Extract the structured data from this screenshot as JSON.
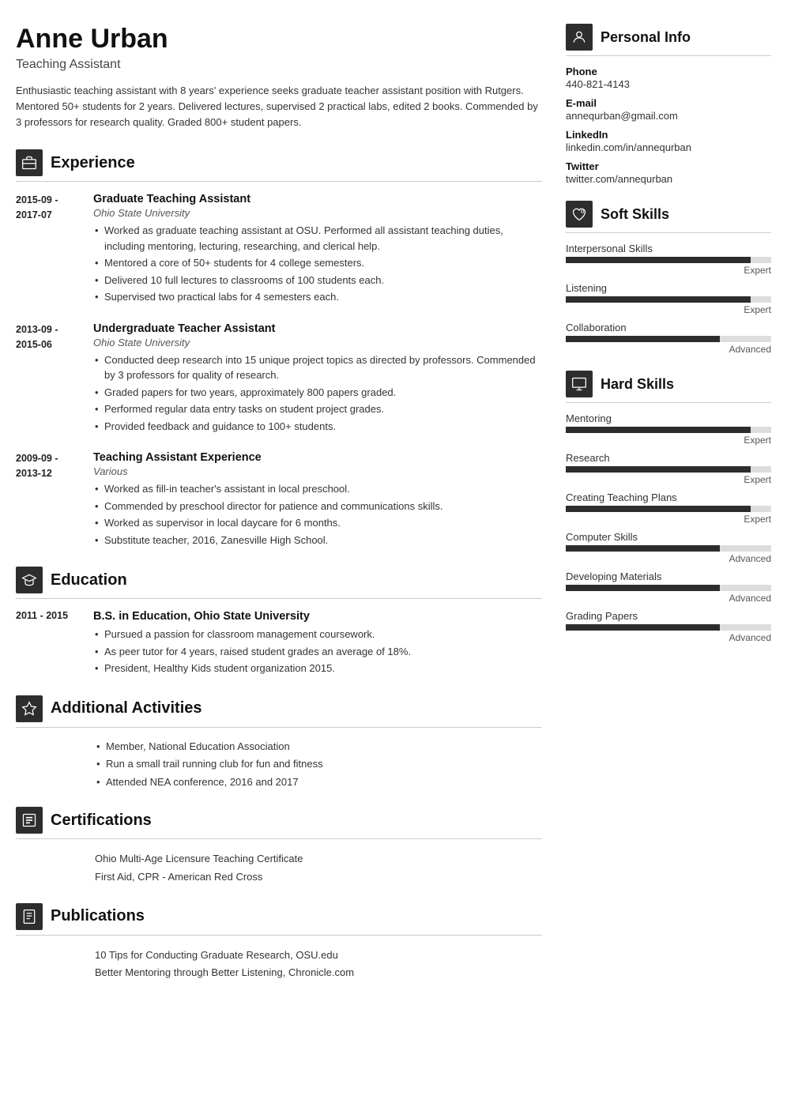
{
  "header": {
    "name": "Anne Urban",
    "title": "Teaching Assistant",
    "summary": "Enthusiastic teaching assistant with 8 years' experience seeks graduate teacher assistant position with Rutgers. Mentored 50+ students for 2 years. Delivered lectures, supervised 2 practical labs, edited 2 books. Commended by 3 professors for research quality. Graded 800+ student papers."
  },
  "sections": {
    "experience": {
      "title": "Experience",
      "entries": [
        {
          "dates": "2015-09 - 2017-07",
          "job_title": "Graduate Teaching Assistant",
          "org": "Ohio State University",
          "bullets": [
            "Worked as graduate teaching assistant at OSU. Performed all assistant teaching duties, including mentoring, lecturing, researching, and clerical help.",
            "Mentored a core of 50+ students for 4 college semesters.",
            "Delivered 10 full lectures to classrooms of 100 students each.",
            "Supervised two practical labs for 4 semesters each."
          ]
        },
        {
          "dates": "2013-09 - 2015-06",
          "job_title": "Undergraduate Teacher Assistant",
          "org": "Ohio State University",
          "bullets": [
            "Conducted deep research into 15 unique project topics as directed by professors. Commended by 3 professors for quality of research.",
            "Graded papers for two years, approximately 800 papers graded.",
            "Performed regular data entry tasks on student project grades.",
            "Provided feedback and guidance to 100+ students."
          ]
        },
        {
          "dates": "2009-09 - 2013-12",
          "job_title": "Teaching Assistant Experience",
          "org": "Various",
          "bullets": [
            "Worked as fill-in teacher's assistant in local preschool.",
            "Commended by preschool director for patience and communications skills.",
            "Worked as supervisor in local daycare for 6 months.",
            "Substitute teacher, 2016, Zanesville High School."
          ]
        }
      ]
    },
    "education": {
      "title": "Education",
      "entries": [
        {
          "dates": "2011 - 2015",
          "degree": "B.S. in Education, Ohio State University",
          "bullets": [
            "Pursued a passion for classroom management coursework.",
            "As peer tutor for 4 years, raised student grades an average of 18%.",
            "President, Healthy Kids student organization 2015."
          ]
        }
      ]
    },
    "additional": {
      "title": "Additional Activities",
      "items": [
        "Member, National Education Association",
        "Run a small trail running club for fun and fitness",
        "Attended NEA conference, 2016 and 2017"
      ]
    },
    "certifications": {
      "title": "Certifications",
      "items": [
        "Ohio Multi-Age Licensure Teaching Certificate",
        "First Aid, CPR - American Red Cross"
      ]
    },
    "publications": {
      "title": "Publications",
      "items": [
        "10 Tips for Conducting Graduate Research, OSU.edu",
        "Better Mentoring through Better Listening, Chronicle.com"
      ]
    }
  },
  "right": {
    "personal_info": {
      "title": "Personal Info",
      "fields": [
        {
          "label": "Phone",
          "value": "440-821-4143"
        },
        {
          "label": "E-mail",
          "value": "annequrban@gmail.com"
        },
        {
          "label": "LinkedIn",
          "value": "linkedin.com/in/annequrban"
        },
        {
          "label": "Twitter",
          "value": "twitter.com/annequrban"
        }
      ]
    },
    "soft_skills": {
      "title": "Soft Skills",
      "skills": [
        {
          "name": "Interpersonal Skills",
          "level_label": "Expert",
          "level_pct": 90
        },
        {
          "name": "Listening",
          "level_label": "Expert",
          "level_pct": 90
        },
        {
          "name": "Collaboration",
          "level_label": "Advanced",
          "level_pct": 75
        }
      ]
    },
    "hard_skills": {
      "title": "Hard Skills",
      "skills": [
        {
          "name": "Mentoring",
          "level_label": "Expert",
          "level_pct": 90
        },
        {
          "name": "Research",
          "level_label": "Expert",
          "level_pct": 90
        },
        {
          "name": "Creating Teaching Plans",
          "level_label": "Expert",
          "level_pct": 90
        },
        {
          "name": "Computer Skills",
          "level_label": "Advanced",
          "level_pct": 75
        },
        {
          "name": "Developing Materials",
          "level_label": "Advanced",
          "level_pct": 75
        },
        {
          "name": "Grading Papers",
          "level_label": "Advanced",
          "level_pct": 75
        }
      ]
    }
  },
  "icons": {
    "experience": "🗂",
    "education": "🎓",
    "additional": "⭐",
    "certifications": "🔲",
    "publications": "📋",
    "personal_info": "👤",
    "soft_skills": "🤝",
    "hard_skills": "🖥"
  }
}
